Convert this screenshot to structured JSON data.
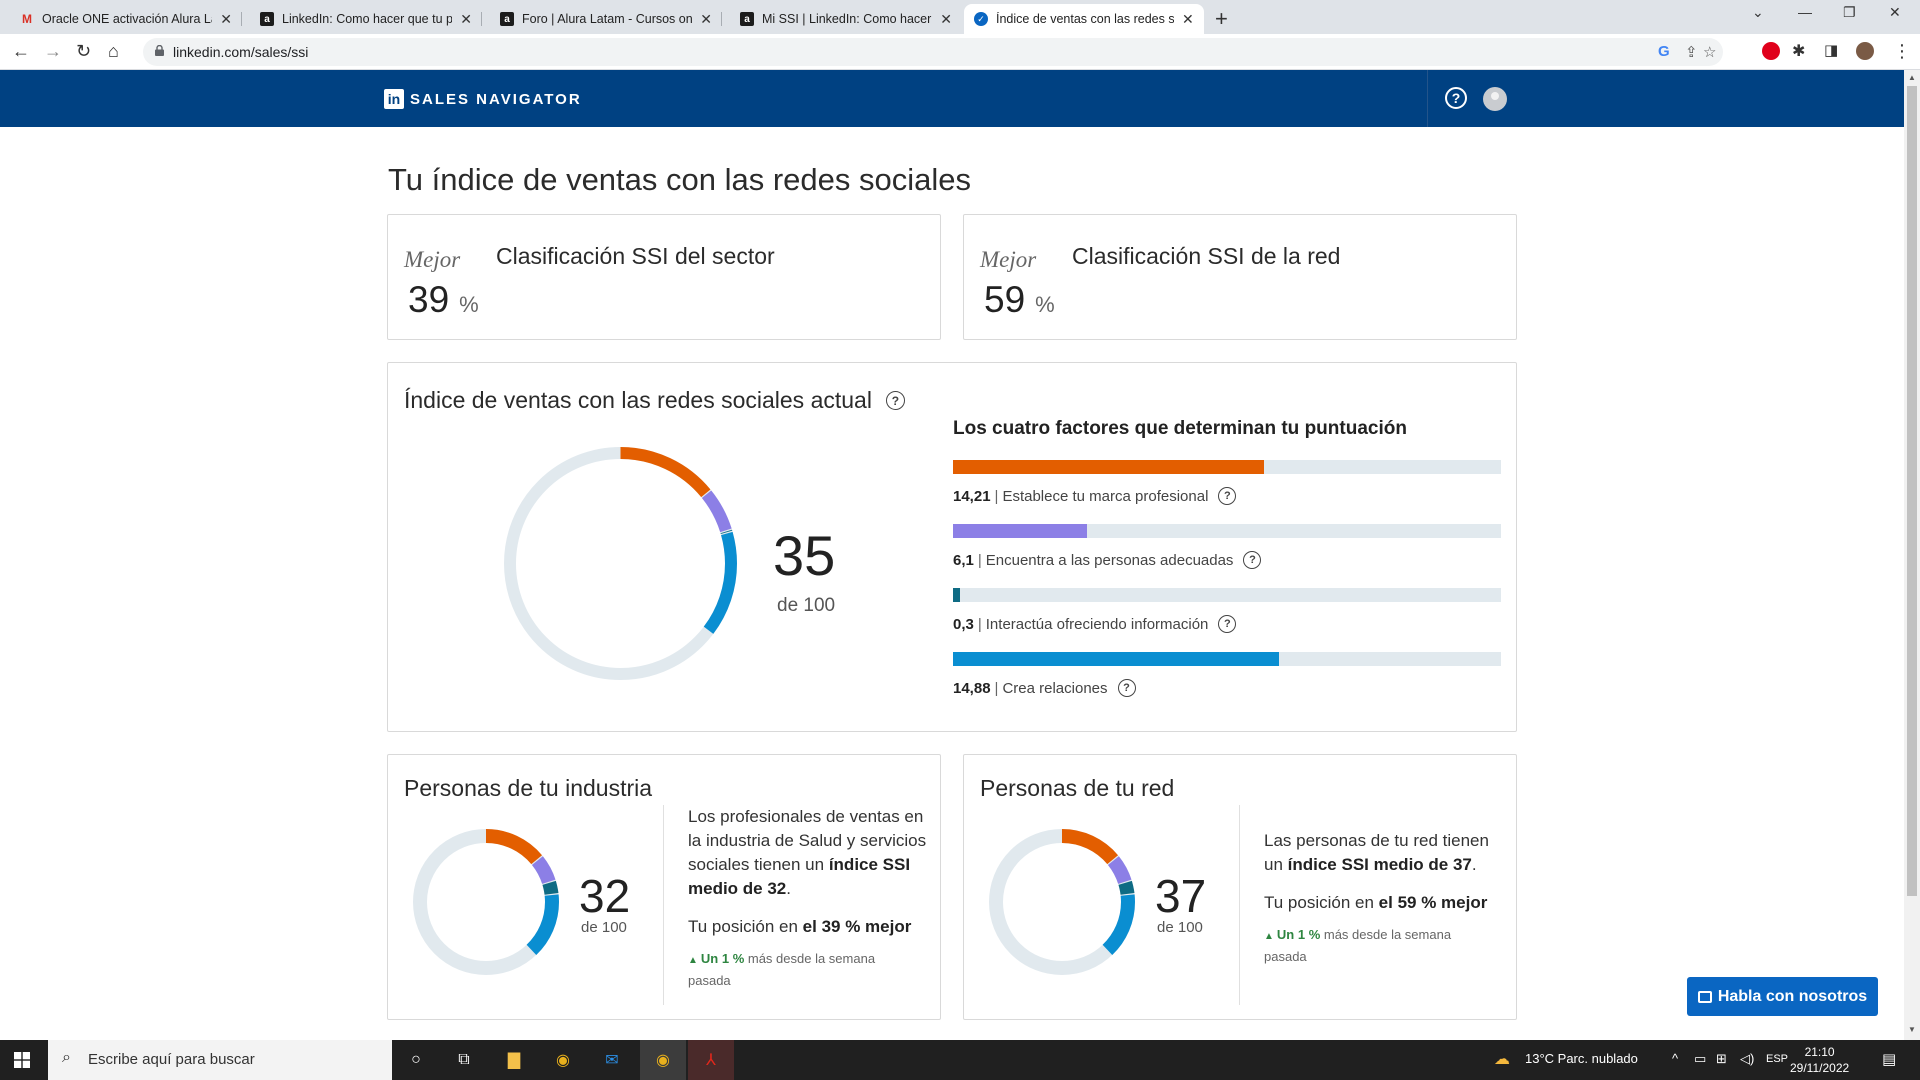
{
  "browser": {
    "tabs": [
      {
        "title": "Oracle ONE activación Alura Latam",
        "icon": "gmail-icon"
      },
      {
        "title": "LinkedIn: Como hacer que tu perfil",
        "icon": "alura-icon"
      },
      {
        "title": "Foro | Alura Latam - Cursos online",
        "icon": "alura-icon"
      },
      {
        "title": "Mi SSI | LinkedIn: Como hacer que",
        "icon": "alura-icon"
      },
      {
        "title": "Índice de ventas con las redes sociales",
        "icon": "linkedin-icon",
        "active": true
      }
    ],
    "url": "linkedin.com/sales/ssi"
  },
  "header": {
    "brand": "SALES NAVIGATOR",
    "logo": "in"
  },
  "page": {
    "title": "Tu índice de ventas con las redes sociales"
  },
  "rank_sector": {
    "qualifier": "Mejor",
    "title": "Clasificación SSI del sector",
    "value": "39",
    "unit": "%"
  },
  "rank_network": {
    "qualifier": "Mejor",
    "title": "Clasificación SSI de la red",
    "value": "59",
    "unit": "%"
  },
  "ssi": {
    "title": "Índice de ventas con las redes sociales actual",
    "score": "35",
    "score_of": "de 100",
    "factors_title": "Los cuatro factores que determinan tu puntuación",
    "factors": [
      {
        "value": "14,21",
        "label": "Establece tu marca profesional",
        "num": 14.21,
        "max": 25,
        "color": "#e35e00"
      },
      {
        "value": "6,1",
        "label": "Encuentra a las personas adecuadas",
        "num": 6.1,
        "max": 25,
        "color": "#8c7fe6"
      },
      {
        "value": "0,3",
        "label": "Interactúa ofreciendo información",
        "num": 0.3,
        "max": 25,
        "color": "#0e6b84"
      },
      {
        "value": "14,88",
        "label": "Crea relaciones",
        "num": 14.88,
        "max": 25,
        "color": "#0a8ed1"
      }
    ]
  },
  "industry": {
    "title": "Personas de tu industria",
    "score": "32",
    "score_of": "de 100",
    "text_1": "Los profesionales de ventas en la industria de Salud y servicios sociales tienen un ",
    "text_bold": "índice SSI medio de 32",
    "text_end": ".",
    "position_label": "Tu posición en ",
    "position_bold": "el 39 % mejor",
    "trend_bold": "Un 1 %",
    "trend_text": " más desde la semana pasada",
    "segments": [
      14.21,
      6.1,
      3.0,
      14.88
    ]
  },
  "network": {
    "title": "Personas de tu red",
    "score": "37",
    "score_of": "de 100",
    "text_1": "Las personas de tu red tienen un ",
    "text_bold": "índice SSI medio de 37",
    "text_end": ".",
    "position_label": "Tu posición en ",
    "position_bold": "el 59 % mejor",
    "trend_bold": "Un 1 %",
    "trend_text": " más desde la semana pasada",
    "segments": [
      14.21,
      6.1,
      3.0,
      14.88
    ]
  },
  "chat_button": "Habla con nosotros",
  "taskbar": {
    "search_placeholder": "Escribe aquí para buscar",
    "weather": "13°C  Parc. nublado",
    "lang": "ESP",
    "time": "21:10",
    "date": "29/11/2022"
  },
  "colors": {
    "brand_header": "#004182",
    "orange": "#e35e00",
    "purple": "#8c7fe6",
    "teal": "#0e6b84",
    "blue": "#0a8ed1",
    "track": "#e1e9ee"
  }
}
